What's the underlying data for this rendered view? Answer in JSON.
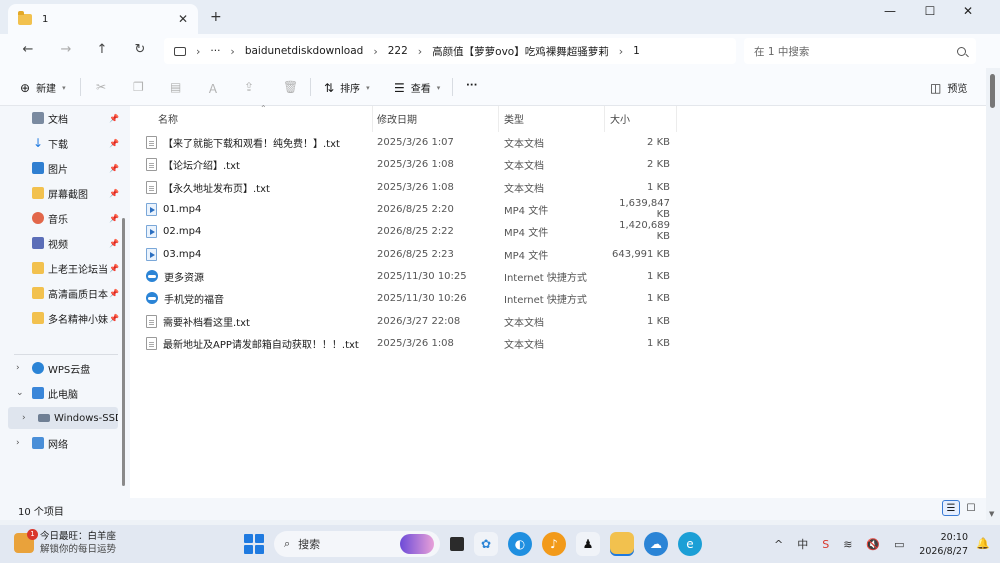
{
  "tab": {
    "title": "1"
  },
  "address": {
    "crumbs": [
      "baidunetdiskdownload",
      "222",
      "高颜值【萝萝ovo】吃鸡裸舞超骚萝莉",
      "1"
    ],
    "ellipsis": "···"
  },
  "search": {
    "placeholder": "在 1 中搜索"
  },
  "toolbar": {
    "new": "新建",
    "sort": "排序",
    "view": "查看",
    "more": "···",
    "preview": "预览"
  },
  "sidebar": {
    "quick": [
      {
        "label": "文档",
        "icon": "document-icon"
      },
      {
        "label": "下载",
        "icon": "download-icon"
      },
      {
        "label": "图片",
        "icon": "picture-icon"
      },
      {
        "label": "屏幕截图",
        "icon": "folder-icon"
      },
      {
        "label": "音乐",
        "icon": "music-icon"
      },
      {
        "label": "视频",
        "icon": "video-icon"
      },
      {
        "label": "上老王论坛当",
        "icon": "folder-icon"
      },
      {
        "label": "高清画质日本",
        "icon": "folder-icon"
      },
      {
        "label": "多名精神小妹",
        "icon": "folder-icon"
      }
    ],
    "tree": [
      {
        "label": "WPS云盘",
        "icon": "cloud-icon",
        "chev": "›"
      },
      {
        "label": "此电脑",
        "icon": "pc-icon",
        "chev": "⌄"
      },
      {
        "label": "Windows-SSD",
        "icon": "drive-icon",
        "chev": "›"
      },
      {
        "label": "网络",
        "icon": "network-icon",
        "chev": "›"
      }
    ]
  },
  "columns": {
    "name": "名称",
    "date": "修改日期",
    "type": "类型",
    "size": "大小"
  },
  "files": [
    {
      "name": "【来了就能下载和观看！纯免费！】.txt",
      "date": "2025/3/26 1:07",
      "type": "文本文档",
      "size": "2 KB",
      "kind": "txt"
    },
    {
      "name": "【论坛介绍】.txt",
      "date": "2025/3/26 1:08",
      "type": "文本文档",
      "size": "2 KB",
      "kind": "txt"
    },
    {
      "name": "【永久地址发布页】.txt",
      "date": "2025/3/26 1:08",
      "type": "文本文档",
      "size": "1 KB",
      "kind": "txt"
    },
    {
      "name": "01.mp4",
      "date": "2026/8/25 2:20",
      "type": "MP4 文件",
      "size": "1,639,847 KB",
      "kind": "mp4"
    },
    {
      "name": "02.mp4",
      "date": "2026/8/25 2:22",
      "type": "MP4 文件",
      "size": "1,420,689 KB",
      "kind": "mp4"
    },
    {
      "name": "03.mp4",
      "date": "2026/8/25 2:23",
      "type": "MP4 文件",
      "size": "643,991 KB",
      "kind": "mp4"
    },
    {
      "name": "更多资源",
      "date": "2025/11/30 10:25",
      "type": "Internet 快捷方式",
      "size": "1 KB",
      "kind": "url"
    },
    {
      "name": "手机党的福音",
      "date": "2025/11/30 10:26",
      "type": "Internet 快捷方式",
      "size": "1 KB",
      "kind": "url"
    },
    {
      "name": "需要补档看这里.txt",
      "date": "2026/3/27 22:08",
      "type": "文本文档",
      "size": "1 KB",
      "kind": "txt"
    },
    {
      "name": "最新地址及APP请发邮箱自动获取！！！.txt",
      "date": "2025/3/26 1:08",
      "type": "文本文档",
      "size": "1 KB",
      "kind": "txt"
    }
  ],
  "status": {
    "count": "10 个项目"
  },
  "taskbar": {
    "weather_title": "今日最旺：白羊座",
    "weather_sub": "解锁你的每日运势",
    "weather_badge": "1",
    "search_label": "搜索",
    "tray_input": "中",
    "time": "20:10",
    "date": "2026/8/27"
  }
}
